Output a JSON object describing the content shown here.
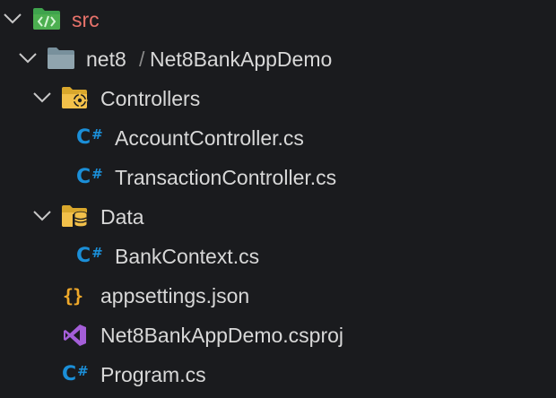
{
  "explorer": {
    "root": {
      "label": "src",
      "icon": "folder-code-icon",
      "color": "#e8736b",
      "folder_color": "#3fa34d"
    },
    "project": {
      "label_parent": "net8",
      "separator": "/",
      "label": "Net8BankAppDemo",
      "icon": "folder-icon"
    },
    "controllers": {
      "label": "Controllers",
      "icon": "folder-gear-icon"
    },
    "account_controller": {
      "label": "AccountController.cs",
      "icon": "csharp-icon"
    },
    "transaction_controller": {
      "label": "TransactionController.cs",
      "icon": "csharp-icon"
    },
    "data": {
      "label": "Data",
      "icon": "folder-database-icon"
    },
    "bank_context": {
      "label": "BankContext.cs",
      "icon": "csharp-icon"
    },
    "appsettings": {
      "label": "appsettings.json",
      "icon": "json-braces-icon",
      "glyph": "{}"
    },
    "csproj": {
      "label": "Net8BankAppDemo.csproj",
      "icon": "visual-studio-icon"
    },
    "program": {
      "label": "Program.cs",
      "icon": "csharp-icon"
    }
  },
  "glyphs": {
    "csharp_c": "C",
    "csharp_hash": "#"
  },
  "colors": {
    "background": "#1a1b1e",
    "text": "#d8d8d8",
    "root_text": "#e8736b",
    "csharp": "#1b8fd8",
    "json": "#f0a92a",
    "folder_yellow": "#f2c04a",
    "folder_gray": "#90a4ae",
    "csproj_purple": "#a45ed8"
  }
}
